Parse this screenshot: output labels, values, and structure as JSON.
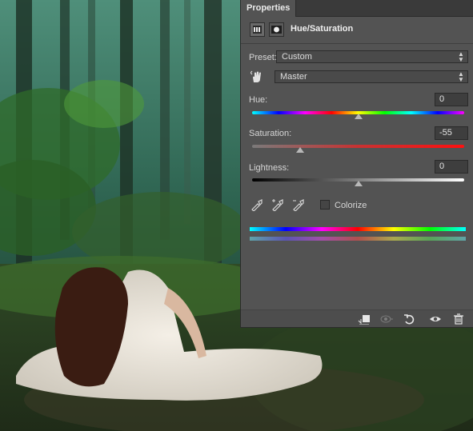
{
  "panel": {
    "tab_label": "Properties",
    "title": "Hue/Saturation",
    "preset_label": "Preset:",
    "preset_value": "Custom",
    "channel_value": "Master",
    "hue_label": "Hue:",
    "hue_value": "0",
    "saturation_label": "Saturation:",
    "saturation_value": "-55",
    "lightness_label": "Lightness:",
    "lightness_value": "0",
    "colorize_label": "Colorize",
    "colorize_checked": false
  },
  "sliders": {
    "hue_fraction": 0.5,
    "saturation_fraction": 0.225,
    "lightness_fraction": 0.5
  },
  "footer_icons": [
    "clip-to-layer-icon",
    "view-previous-state-icon",
    "reset-icon",
    "visibility-eye-icon",
    "delete-trash-icon"
  ],
  "colors": {
    "panel_bg": "#535353",
    "tab_bg": "#3a3a3a"
  }
}
